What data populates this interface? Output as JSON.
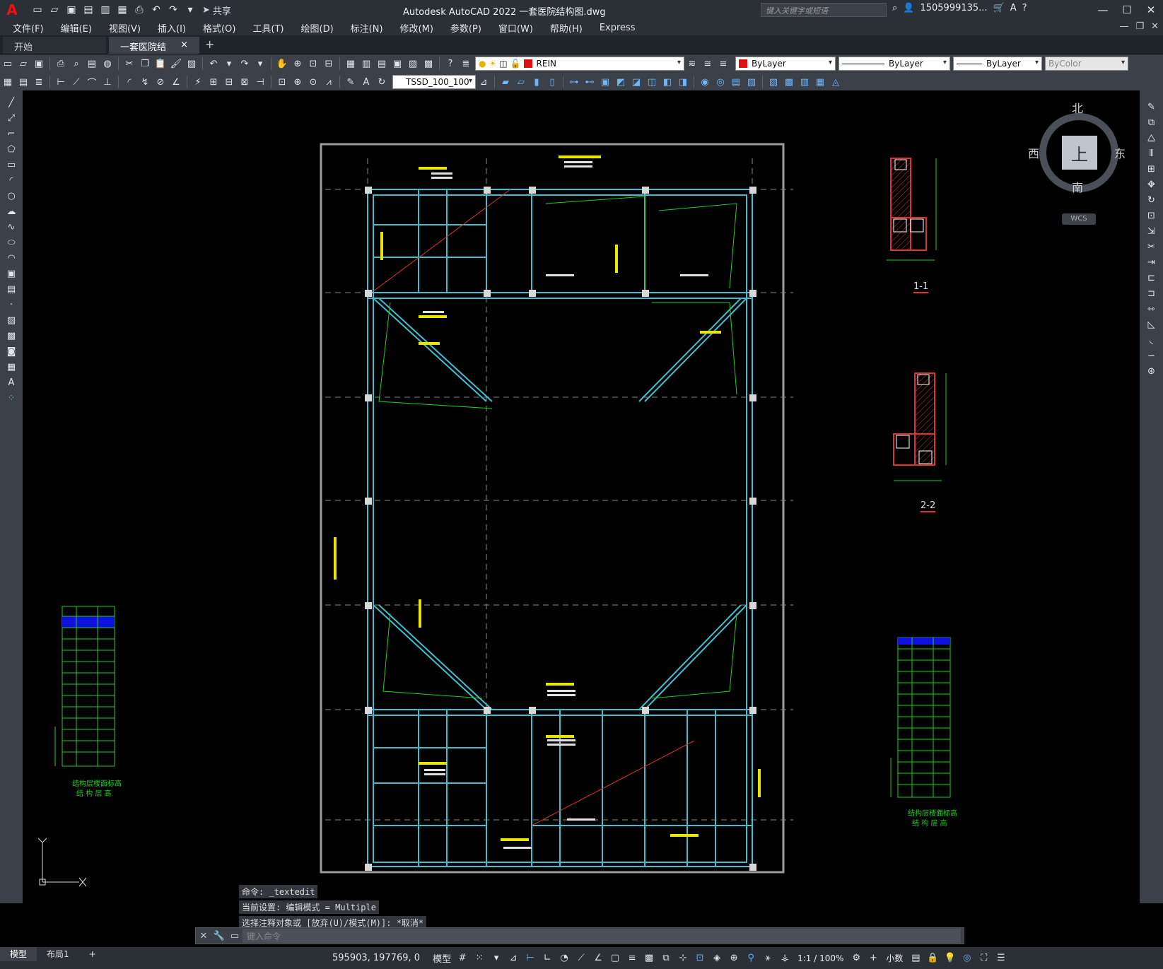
{
  "titlebar": {
    "app_title": "Autodesk AutoCAD 2022    一套医院结构图.dwg",
    "share_label": "共享",
    "search_placeholder": "键入关键字或短语",
    "user": "1505999135...",
    "window_controls": [
      "minimize",
      "maximize",
      "close"
    ]
  },
  "menu": [
    "文件(F)",
    "编辑(E)",
    "视图(V)",
    "插入(I)",
    "格式(O)",
    "工具(T)",
    "绘图(D)",
    "标注(N)",
    "修改(M)",
    "参数(P)",
    "窗口(W)",
    "帮助(H)",
    "Express"
  ],
  "tabs": [
    {
      "label": "开始"
    },
    {
      "label": "一套医院结构图*",
      "close": "×"
    }
  ],
  "toolbar1": {
    "layer_name": "REIN",
    "layer_color": "#e01010",
    "color_label": "ByLayer",
    "color_swatch": "#e01010",
    "linetype_label": "ByLayer",
    "lineweight_label": "ByLayer",
    "plotstyle_label": "ByColor"
  },
  "toolbar2": {
    "dimstyle_label": "TSSD_100_100"
  },
  "viewcube": {
    "north": "北",
    "south": "南",
    "west": "西",
    "east": "东",
    "top": "上",
    "wcs": "WCS"
  },
  "drawing": {
    "section_1_label": "1-1",
    "section_2_label": "2-2",
    "table_left_title1": "结构层楼面标高",
    "table_left_title2": "结 构 层 高",
    "table_right_title1": "结构层楼面标高",
    "table_right_title2": "结 构 层 高"
  },
  "command_history": [
    "命令: _textedit",
    "当前设置: 编辑模式 = Multiple",
    "选择注释对象或 [放弃(U)/模式(M)]: *取消*"
  ],
  "command_placeholder": "键入命令",
  "layout_tabs": [
    "模型",
    "布局1"
  ],
  "status": {
    "coords": "595903, 197769, 0",
    "model_label": "模型",
    "scale": "1:1 / 100%",
    "units": "小数"
  }
}
